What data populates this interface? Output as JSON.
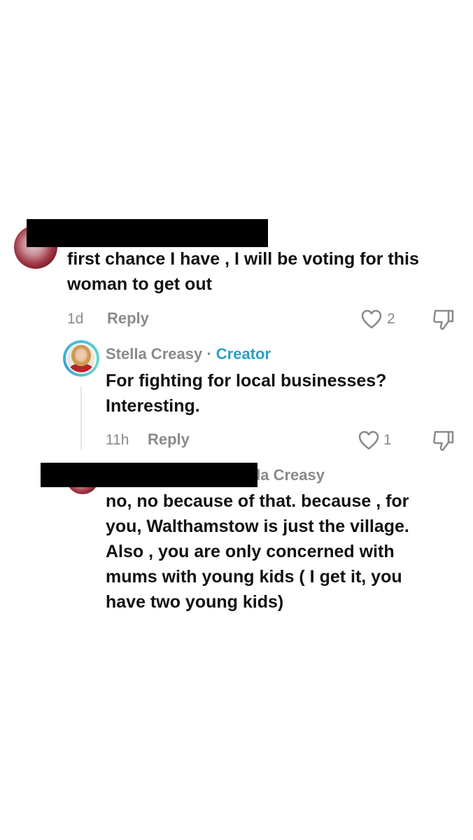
{
  "comment1": {
    "text_line1": "first chance I have , I will be voting for this",
    "text_line2": "woman to get out",
    "age": "1d",
    "reply_label": "Reply",
    "likes": "2"
  },
  "reply1": {
    "author": "Stella Creasy",
    "separator": "·",
    "badge": "Creator",
    "text_line1": "For fighting for local businesses?",
    "text_line2": "Interesting.",
    "age": "11h",
    "reply_label": "Reply",
    "likes": "1"
  },
  "reply2": {
    "mention_partial": "lla Creasy",
    "lines": [
      "no, no because of that. because , for",
      "you, Walthamstow is just the village.",
      "Also , you are only concerned with",
      "mums with young kids ( I get it, you",
      "have two young kids)"
    ]
  },
  "colors": {
    "creator_accent": "#2a9fc0",
    "meta_gray": "#8a8a8a"
  }
}
